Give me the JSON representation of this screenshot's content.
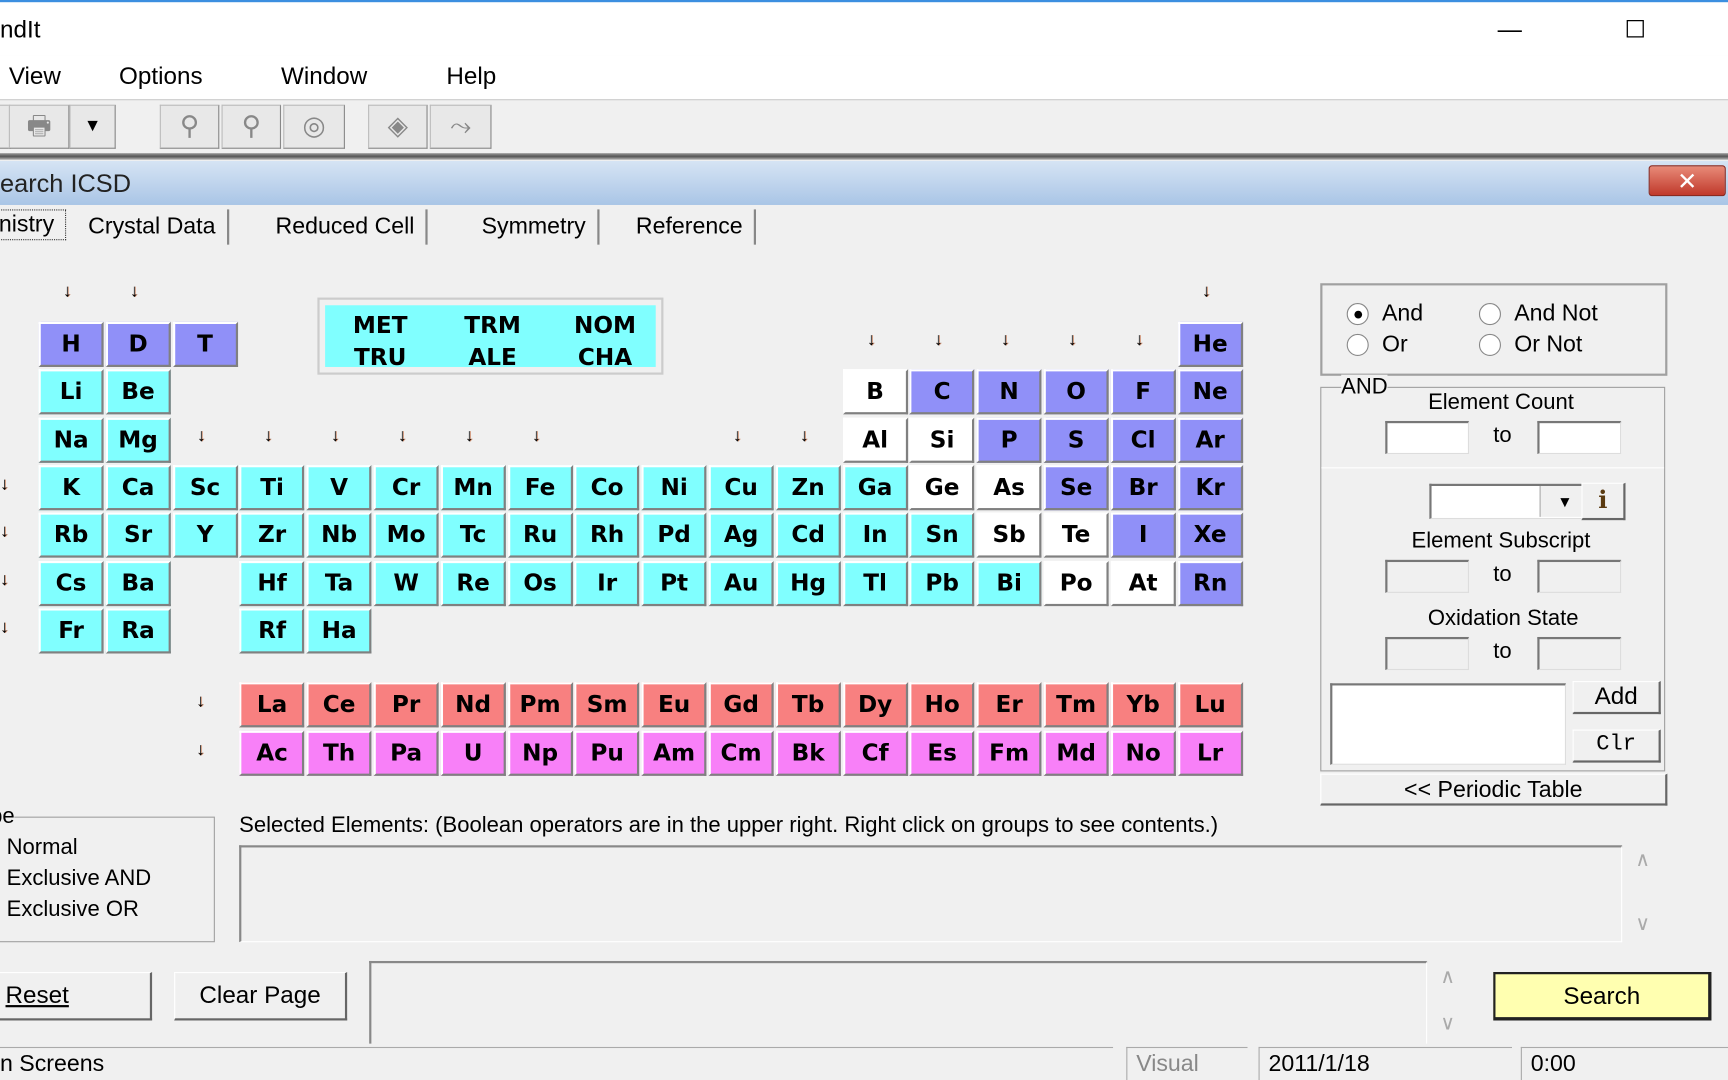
{
  "window": {
    "title": "ndIt",
    "minimize_icon": "minimize-icon",
    "maximize_icon": "maximize-icon"
  },
  "menu": [
    "View",
    "Options",
    "Window",
    "Help"
  ],
  "toolbar": {
    "icons": [
      "printer-icon",
      "dropdown-arrow-icon",
      "search-key-icon",
      "pin-icon",
      "rings-icon",
      "diamond-icon",
      "pathway-icon"
    ]
  },
  "child": {
    "title": "earch ICSD",
    "close": "✕"
  },
  "tabs": [
    {
      "label": "nistry",
      "active": true
    },
    {
      "label": "Crystal Data"
    },
    {
      "label": "Reduced Cell"
    },
    {
      "label": "Symmetry"
    },
    {
      "label": "Reference"
    }
  ],
  "colors": {
    "c": "#80ffff",
    "p": "#9090f8",
    "w": "#ffffff",
    "l": "#f88080",
    "a": "#f880f8"
  },
  "periodic_table": {
    "rows": [
      [
        [
          "H",
          "p"
        ],
        [
          "D",
          "p"
        ],
        [
          "T",
          "p"
        ],
        null,
        null,
        null,
        null,
        null,
        null,
        null,
        null,
        null,
        null,
        null,
        null,
        null,
        null,
        [
          "He",
          "p"
        ]
      ],
      [
        [
          "Li",
          "c"
        ],
        [
          "Be",
          "c"
        ],
        null,
        null,
        null,
        null,
        null,
        null,
        null,
        null,
        null,
        null,
        [
          "B",
          "w"
        ],
        [
          "C",
          "p"
        ],
        [
          "N",
          "p"
        ],
        [
          "O",
          "p"
        ],
        [
          "F",
          "p"
        ],
        [
          "Ne",
          "p"
        ]
      ],
      [
        [
          "Na",
          "c"
        ],
        [
          "Mg",
          "c"
        ],
        null,
        null,
        null,
        null,
        null,
        null,
        null,
        null,
        null,
        null,
        [
          "Al",
          "w"
        ],
        [
          "Si",
          "w"
        ],
        [
          "P",
          "p"
        ],
        [
          "S",
          "p"
        ],
        [
          "Cl",
          "p"
        ],
        [
          "Ar",
          "p"
        ]
      ],
      [
        [
          "K",
          "c"
        ],
        [
          "Ca",
          "c"
        ],
        [
          "Sc",
          "c"
        ],
        [
          "Ti",
          "c"
        ],
        [
          "V",
          "c"
        ],
        [
          "Cr",
          "c"
        ],
        [
          "Mn",
          "c"
        ],
        [
          "Fe",
          "c"
        ],
        [
          "Co",
          "c"
        ],
        [
          "Ni",
          "c"
        ],
        [
          "Cu",
          "c"
        ],
        [
          "Zn",
          "c"
        ],
        [
          "Ga",
          "c"
        ],
        [
          "Ge",
          "w"
        ],
        [
          "As",
          "w"
        ],
        [
          "Se",
          "p"
        ],
        [
          "Br",
          "p"
        ],
        [
          "Kr",
          "p"
        ]
      ],
      [
        [
          "Rb",
          "c"
        ],
        [
          "Sr",
          "c"
        ],
        [
          "Y",
          "c"
        ],
        [
          "Zr",
          "c"
        ],
        [
          "Nb",
          "c"
        ],
        [
          "Mo",
          "c"
        ],
        [
          "Tc",
          "c"
        ],
        [
          "Ru",
          "c"
        ],
        [
          "Rh",
          "c"
        ],
        [
          "Pd",
          "c"
        ],
        [
          "Ag",
          "c"
        ],
        [
          "Cd",
          "c"
        ],
        [
          "In",
          "c"
        ],
        [
          "Sn",
          "c"
        ],
        [
          "Sb",
          "w"
        ],
        [
          "Te",
          "w"
        ],
        [
          "I",
          "p"
        ],
        [
          "Xe",
          "p"
        ]
      ],
      [
        [
          "Cs",
          "c"
        ],
        [
          "Ba",
          "c"
        ],
        null,
        [
          "Hf",
          "c"
        ],
        [
          "Ta",
          "c"
        ],
        [
          "W",
          "c"
        ],
        [
          "Re",
          "c"
        ],
        [
          "Os",
          "c"
        ],
        [
          "Ir",
          "c"
        ],
        [
          "Pt",
          "c"
        ],
        [
          "Au",
          "c"
        ],
        [
          "Hg",
          "c"
        ],
        [
          "Tl",
          "c"
        ],
        [
          "Pb",
          "c"
        ],
        [
          "Bi",
          "c"
        ],
        [
          "Po",
          "w"
        ],
        [
          "At",
          "w"
        ],
        [
          "Rn",
          "p"
        ]
      ],
      [
        [
          "Fr",
          "c"
        ],
        [
          "Ra",
          "c"
        ],
        null,
        [
          "Rf",
          "c"
        ],
        [
          "Ha",
          "c"
        ]
      ]
    ],
    "lanthanides": [
      "La",
      "Ce",
      "Pr",
      "Nd",
      "Pm",
      "Sm",
      "Eu",
      "Gd",
      "Tb",
      "Dy",
      "Ho",
      "Er",
      "Tm",
      "Yb",
      "Lu"
    ],
    "actinides": [
      "Ac",
      "Th",
      "Pa",
      "U",
      "Np",
      "Pu",
      "Am",
      "Cm",
      "Bk",
      "Cf",
      "Es",
      "Fm",
      "Md",
      "No",
      "Lr"
    ],
    "groups": [
      "MET",
      "TRM",
      "NOM",
      "TRU",
      "ALE",
      "CHA"
    ]
  },
  "boolean": {
    "options": [
      "And",
      "And Not",
      "Or",
      "Or Not"
    ],
    "selected": "And"
  },
  "and_panel": {
    "legend": "AND",
    "element_count": "Element Count",
    "to": "to",
    "element_subscript": "Element Subscript",
    "oxidation_state": "Oxidation State",
    "info": "i",
    "add": "Add",
    "clr": "Clr",
    "periodic_table_btn": "<< Periodic Table"
  },
  "type_group": {
    "legend": "pe",
    "options": [
      "Normal",
      "Exclusive AND",
      "Exclusive OR"
    ]
  },
  "selected_elements_label": "Selected Elements: (Boolean operators are in the upper right.  Right click on groups to see contents.)",
  "buttons": {
    "reset": "Reset",
    "clear_page": "Clear Page",
    "search": "Search"
  },
  "status": {
    "left": "n Screens",
    "mode": "Visual",
    "date": "2011/1/18",
    "time": "0:00"
  }
}
